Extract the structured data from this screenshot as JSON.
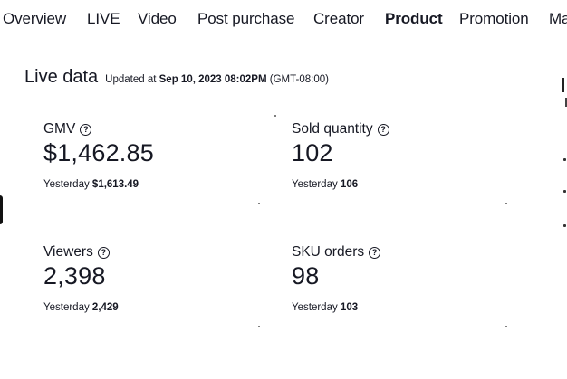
{
  "nav": {
    "tabs": [
      {
        "label": "Overview",
        "active": false
      },
      {
        "label": "LIVE",
        "active": false
      },
      {
        "label": "Video",
        "active": false
      },
      {
        "label": "Post purchase",
        "active": false
      },
      {
        "label": "Creator",
        "active": false
      },
      {
        "label": "Product",
        "active": true
      },
      {
        "label": "Promotion",
        "active": false
      },
      {
        "label": "Ma",
        "active": false
      }
    ]
  },
  "live_data": {
    "title": "Live data",
    "updated_prefix": "Updated at ",
    "updated_time": "Sep 10, 2023 08:02PM",
    "timezone": " (GMT-08:00)"
  },
  "metrics": [
    {
      "label": "GMV",
      "value": "$1,462.85",
      "compare_label": "Yesterday ",
      "compare_value": "$1,613.49"
    },
    {
      "label": "Sold quantity",
      "value": "102",
      "compare_label": "Yesterday ",
      "compare_value": "106"
    },
    {
      "label": "Viewers",
      "value": "2,398",
      "compare_label": "Yesterday ",
      "compare_value": "2,429"
    },
    {
      "label": "SKU orders",
      "value": "98",
      "compare_label": "Yesterday ",
      "compare_value": "103"
    }
  ],
  "icons": {
    "help": "help-circle-icon",
    "help_glyph": "?"
  },
  "colors": {
    "text": "#161823",
    "background": "#ffffff"
  }
}
